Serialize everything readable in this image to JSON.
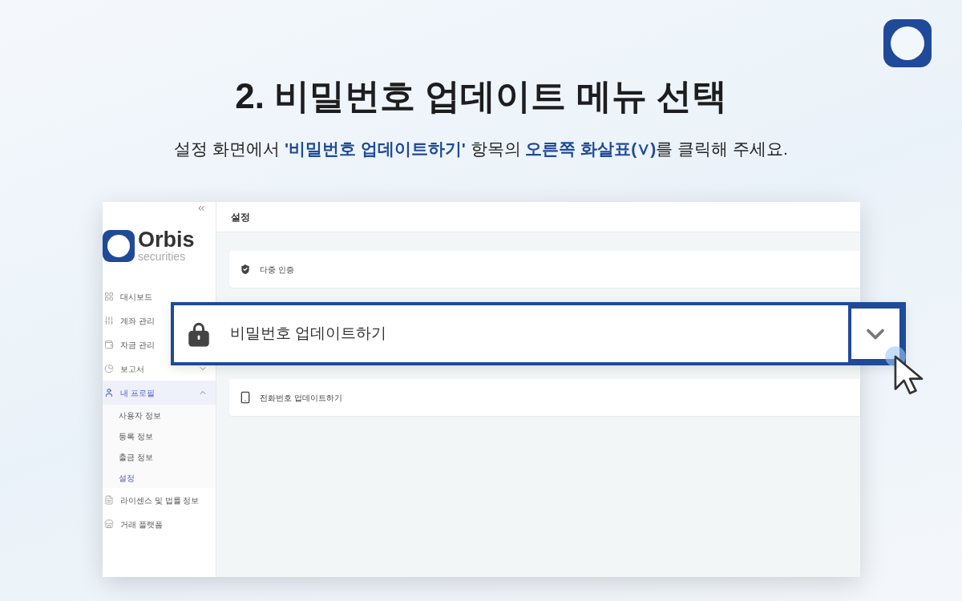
{
  "title": "2. 비밀번호 업데이트 메뉴 선택",
  "subtitle": "설정 화면에서 **'비밀번호 업데이트하기'** 항목의 **오른쪽 화살표(∨)**를 클릭해 주세요.",
  "app": {
    "logo": {
      "name": "Orbis",
      "tagline": "securities"
    },
    "sidebar": {
      "items": [
        {
          "label": "대시보드",
          "selected": false
        },
        {
          "label": "계좌 관리",
          "selected": false
        },
        {
          "label": "자금 관리",
          "selected": false
        },
        {
          "label": "보고서",
          "selected": false,
          "expanded": false
        },
        {
          "label": "내 프로필",
          "selected": true,
          "expanded": true,
          "children": [
            {
              "label": "사용자 정보",
              "selected": false
            },
            {
              "label": "등록 정보",
              "selected": false
            },
            {
              "label": "출금 정보",
              "selected": false
            },
            {
              "label": "설정",
              "selected": true
            }
          ]
        },
        {
          "label": "라이센스 및 법률 정보",
          "selected": false
        },
        {
          "label": "거래 플랫폼",
          "selected": false
        }
      ]
    },
    "header": "설정",
    "settings": [
      {
        "label": "다중 인증",
        "highlighted": false
      },
      {
        "label": "비밀번호 업데이트하기",
        "highlighted": true
      },
      {
        "label": "전화번호 업데이트하기",
        "highlighted": false
      }
    ]
  }
}
